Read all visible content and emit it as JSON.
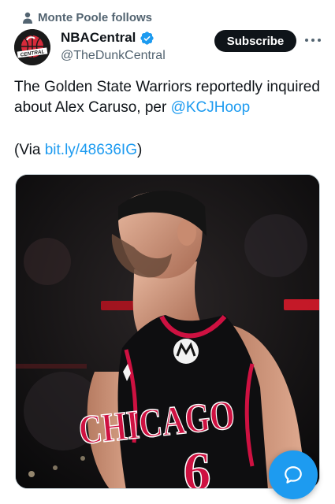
{
  "social_context": {
    "text": "Monte Poole follows",
    "icon": "person-icon"
  },
  "author": {
    "display_name": "NBACentral",
    "handle": "@TheDunkCentral",
    "verified": true,
    "avatar_text": "CENTRAL",
    "avatar_icon": "basketball-logo"
  },
  "actions": {
    "subscribe_label": "Subscribe",
    "more_icon": "more-icon"
  },
  "tweet": {
    "text_before": "The Golden State Warriors reportedly inquired about Alex Caruso, per ",
    "mention": "@KCJHoop",
    "via_prefix": "(Via ",
    "via_link": "bit.ly/48636IG",
    "via_suffix": ")"
  },
  "media": {
    "jersey_text": "CHICAGO",
    "jersey_number": "6",
    "description_icon": "player-photo"
  },
  "fab": {
    "icon": "compose-icon"
  },
  "colors": {
    "link": "#1d9bf0",
    "verified": "#1d9bf0",
    "button_bg": "#0f1419",
    "secondary_text": "#536471",
    "jersey_red": "#ce1141"
  }
}
